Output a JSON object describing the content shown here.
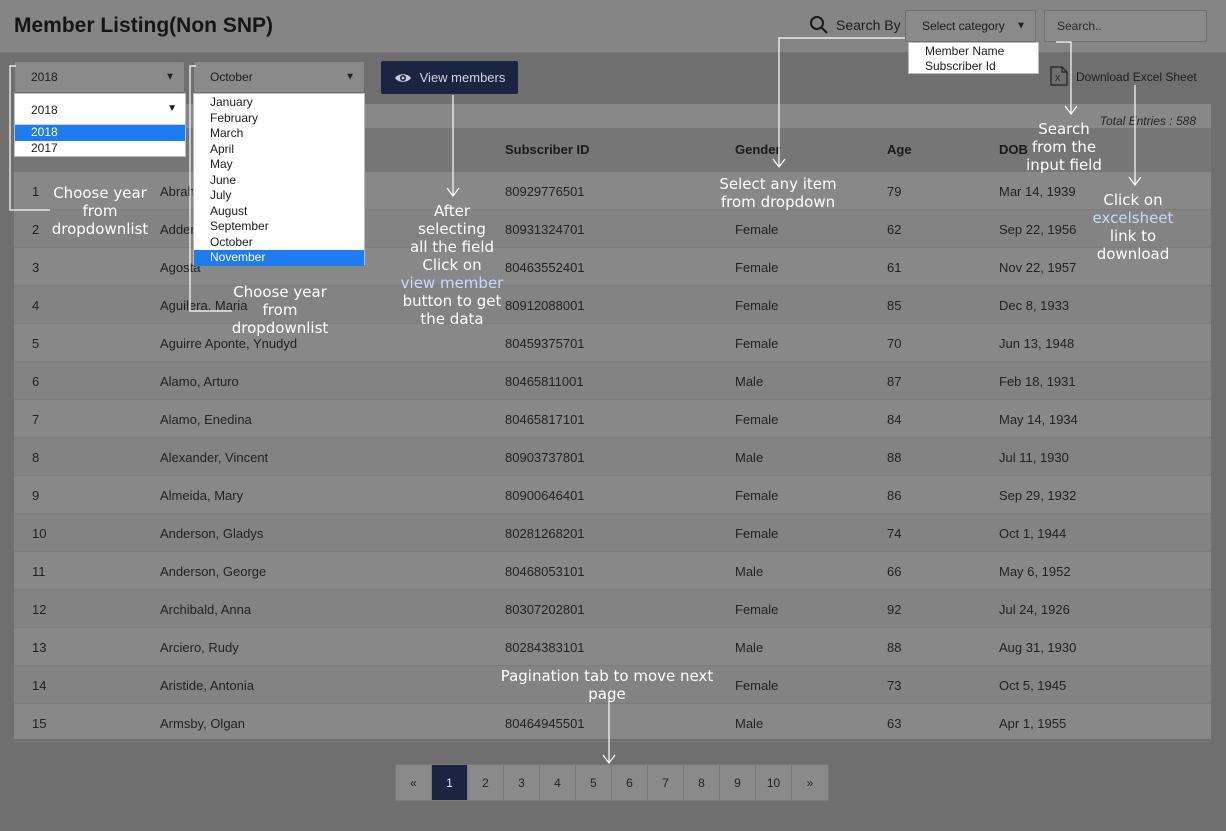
{
  "header": {
    "title": "Member Listing(Non SNP)",
    "search_by_label": "Search By",
    "category_select": "Select category",
    "category_options": [
      "Member Name",
      "Subscriber Id"
    ],
    "search_placeholder": "Search.."
  },
  "filters": {
    "year_value": "2018",
    "year_open_value": "2018",
    "year_options": [
      "2018",
      "2017"
    ],
    "month_value": "October",
    "month_options": [
      "January",
      "February",
      "March",
      "April",
      "May",
      "June",
      "July",
      "August",
      "September",
      "October",
      "November"
    ],
    "view_button": "View members",
    "excel_link": "Download Excel Sheet"
  },
  "table": {
    "total_entries": "Total Entries : 588",
    "headers": {
      "subscriber_id": "Subscriber ID",
      "gender": "Gender",
      "age": "Age",
      "dob": "DOB"
    },
    "rows": [
      {
        "no": "1",
        "name": "Abraha",
        "sid": "80929776501",
        "gender": "",
        "age": "79",
        "dob": "Mar 14, 1939"
      },
      {
        "no": "2",
        "name": "Adder",
        "sid": "80931324701",
        "gender": "Female",
        "age": "62",
        "dob": "Sep 22, 1956"
      },
      {
        "no": "3",
        "name": "Agosta",
        "sid": "80463552401",
        "gender": "Female",
        "age": "61",
        "dob": "Nov 22, 1957"
      },
      {
        "no": "4",
        "name": "Aguilera, Maria",
        "sid": "80912088001",
        "gender": "Female",
        "age": "85",
        "dob": "Dec 8, 1933"
      },
      {
        "no": "5",
        "name": "Aguirre Aponte, Ynudyd",
        "sid": "80459375701",
        "gender": "Female",
        "age": "70",
        "dob": "Jun 13, 1948"
      },
      {
        "no": "6",
        "name": "Alamo, Arturo",
        "sid": "80465811001",
        "gender": "Male",
        "age": "87",
        "dob": "Feb 18, 1931"
      },
      {
        "no": "7",
        "name": "Alamo, Enedina",
        "sid": "80465817101",
        "gender": "Female",
        "age": "84",
        "dob": "May 14, 1934"
      },
      {
        "no": "8",
        "name": "Alexander, Vincent",
        "sid": "80903737801",
        "gender": "Male",
        "age": "88",
        "dob": "Jul 11, 1930"
      },
      {
        "no": "9",
        "name": "Almeida, Mary",
        "sid": "80900646401",
        "gender": "Female",
        "age": "86",
        "dob": "Sep 29, 1932"
      },
      {
        "no": "10",
        "name": "Anderson, Gladys",
        "sid": "80281268201",
        "gender": "Female",
        "age": "74",
        "dob": "Oct 1, 1944"
      },
      {
        "no": "11",
        "name": "Anderson, George",
        "sid": "80468053101",
        "gender": "Male",
        "age": "66",
        "dob": "May 6, 1952"
      },
      {
        "no": "12",
        "name": "Archibald, Anna",
        "sid": "80307202801",
        "gender": "Female",
        "age": "92",
        "dob": "Jul 24, 1926"
      },
      {
        "no": "13",
        "name": "Arciero, Rudy",
        "sid": "80284383101",
        "gender": "Male",
        "age": "88",
        "dob": "Aug 31, 1930"
      },
      {
        "no": "14",
        "name": "Aristide, Antonia",
        "sid": "",
        "gender": "Female",
        "age": "73",
        "dob": "Oct 5, 1945"
      },
      {
        "no": "15",
        "name": "Armsby, Olgan",
        "sid": "80464945501",
        "gender": "Male",
        "age": "63",
        "dob": "Apr 1, 1955"
      }
    ]
  },
  "pagination": {
    "prev": "«",
    "pages": [
      "1",
      "2",
      "3",
      "4",
      "5",
      "6",
      "7",
      "8",
      "9",
      "10"
    ],
    "next": "»",
    "active": "1"
  },
  "annotations": {
    "year_1": [
      "Choose year",
      "from",
      "dropdownlist"
    ],
    "year_2": [
      "Choose year",
      "from",
      "dropdownlist"
    ],
    "view": [
      "After selecting",
      "all  the field",
      "Click on",
      "view member",
      "button to get",
      "the data"
    ],
    "category": [
      "Select any item",
      "from dropdown"
    ],
    "search": [
      "Search",
      "from the",
      "input field"
    ],
    "excel": [
      "Click on",
      "excelsheet",
      "link to",
      "download"
    ],
    "pagination": [
      "Pagination tab to move next page"
    ]
  },
  "colors": {
    "accent": "#1b2440",
    "highlight": "#1e7cf0",
    "annotation": "#ffffff"
  }
}
